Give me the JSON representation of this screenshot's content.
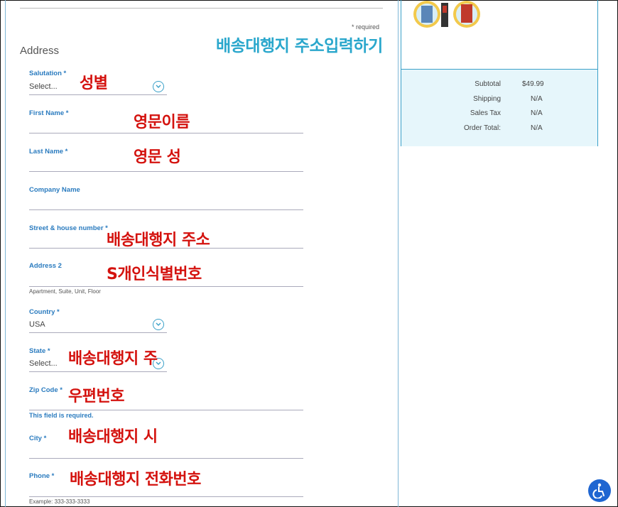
{
  "form": {
    "required_note": "* required",
    "section_title": "Address",
    "annotation_title": "배송대행지 주소입력하기",
    "fields": [
      {
        "label": "Salutation *",
        "value": "Select...",
        "annotation": "성별"
      },
      {
        "label": "First Name *",
        "value": "",
        "annotation": "영문이름"
      },
      {
        "label": "Last Name *",
        "value": "",
        "annotation": "영문 성"
      },
      {
        "label": "Company Name",
        "value": "",
        "annotation": ""
      },
      {
        "label": "Street & house number *",
        "value": "",
        "annotation": "배송대행지 주소"
      },
      {
        "label": "Address 2",
        "value": "",
        "hint": "Apartment, Suite, Unit, Floor",
        "annotation": "S개인식별번호"
      },
      {
        "label": "Country *",
        "value": "USA",
        "annotation": ""
      },
      {
        "label": "State *",
        "value": "Select...",
        "annotation": "배송대행지 주"
      },
      {
        "label": "Zip Code *",
        "value": "",
        "error": "This field is required.",
        "annotation": "우편번호"
      },
      {
        "label": "City *",
        "value": "",
        "annotation": "배송대행지 시"
      },
      {
        "label": "Phone *",
        "value": "",
        "hint": "Example: 333-333-3333",
        "annotation": "배송대행지 전화번호"
      }
    ]
  },
  "summary": {
    "rows": [
      {
        "label": "Subtotal",
        "value": "$49.99"
      },
      {
        "label": "Shipping",
        "value": "N/A"
      },
      {
        "label": "Sales Tax",
        "value": "N/A"
      },
      {
        "label": "Order Total:",
        "value": "N/A"
      }
    ]
  },
  "icons": {
    "select_arrow": "chevron-down-icon",
    "accessibility": "accessibility-icon"
  },
  "colors": {
    "label_blue": "#2a7bbf",
    "annotation_red": "#d4120e",
    "annotation_cyan": "#2aa7cc",
    "summary_bg": "#e6f6fb"
  }
}
